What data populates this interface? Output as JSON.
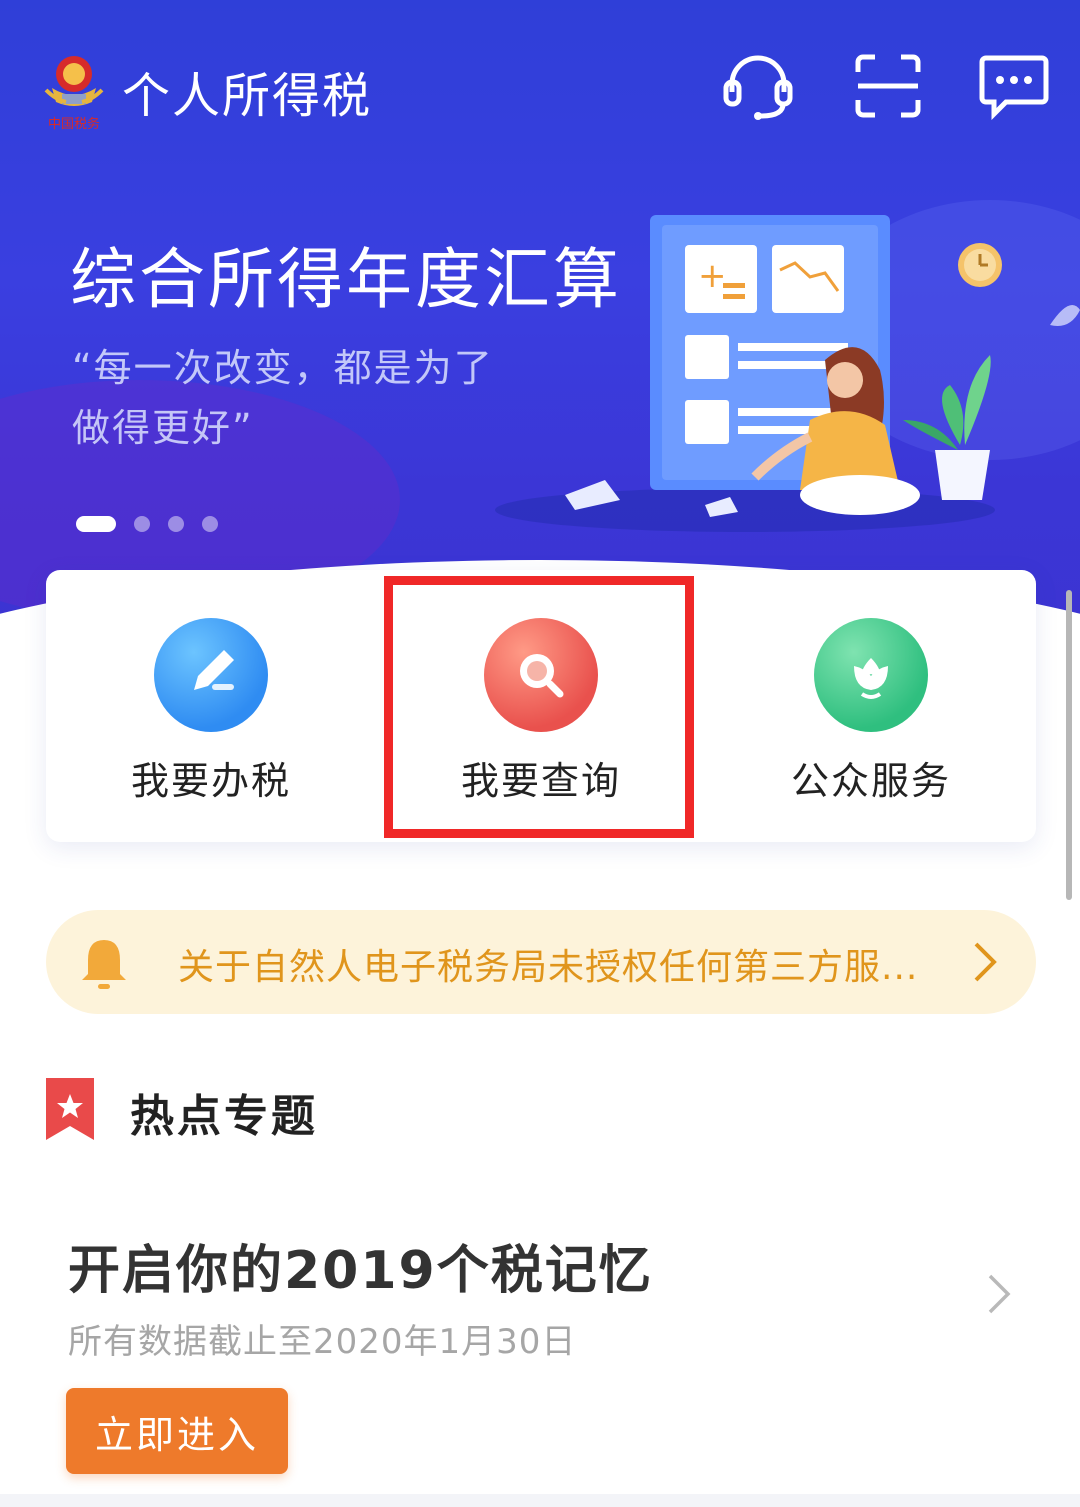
{
  "header": {
    "app_title": "个人所得税",
    "logo_caption": "中国税务",
    "icons": [
      "headset-icon",
      "scan-icon",
      "chat-icon"
    ]
  },
  "banner": {
    "title": "综合所得年度汇算",
    "quote": "“每一次改变，都是为了做得更好”",
    "carousel_total": 4,
    "carousel_active": 1
  },
  "actions": [
    {
      "label": "我要办税",
      "icon": "edit-icon",
      "color": "#2f8cf2"
    },
    {
      "label": "我要查询",
      "icon": "search-icon",
      "color": "#e9514d"
    },
    {
      "label": "公众服务",
      "icon": "flower-icon",
      "color": "#2fbf7f"
    }
  ],
  "notice": {
    "text": "关于自然人电子税务局未授权任何第三方服...",
    "icon": "bell-icon"
  },
  "hot_topics": {
    "title": "热点专题",
    "feature": {
      "title": "开启你的2019个税记忆",
      "subtitle": "所有数据截止至2020年1月30日",
      "button": "立即进入"
    }
  },
  "colors": {
    "hero_blue": "#3a3fe0",
    "notice_bg": "#fdf3da",
    "notice_text": "#e0951c",
    "cta_orange": "#ee7a2b",
    "highlight_red": "#f02828"
  }
}
